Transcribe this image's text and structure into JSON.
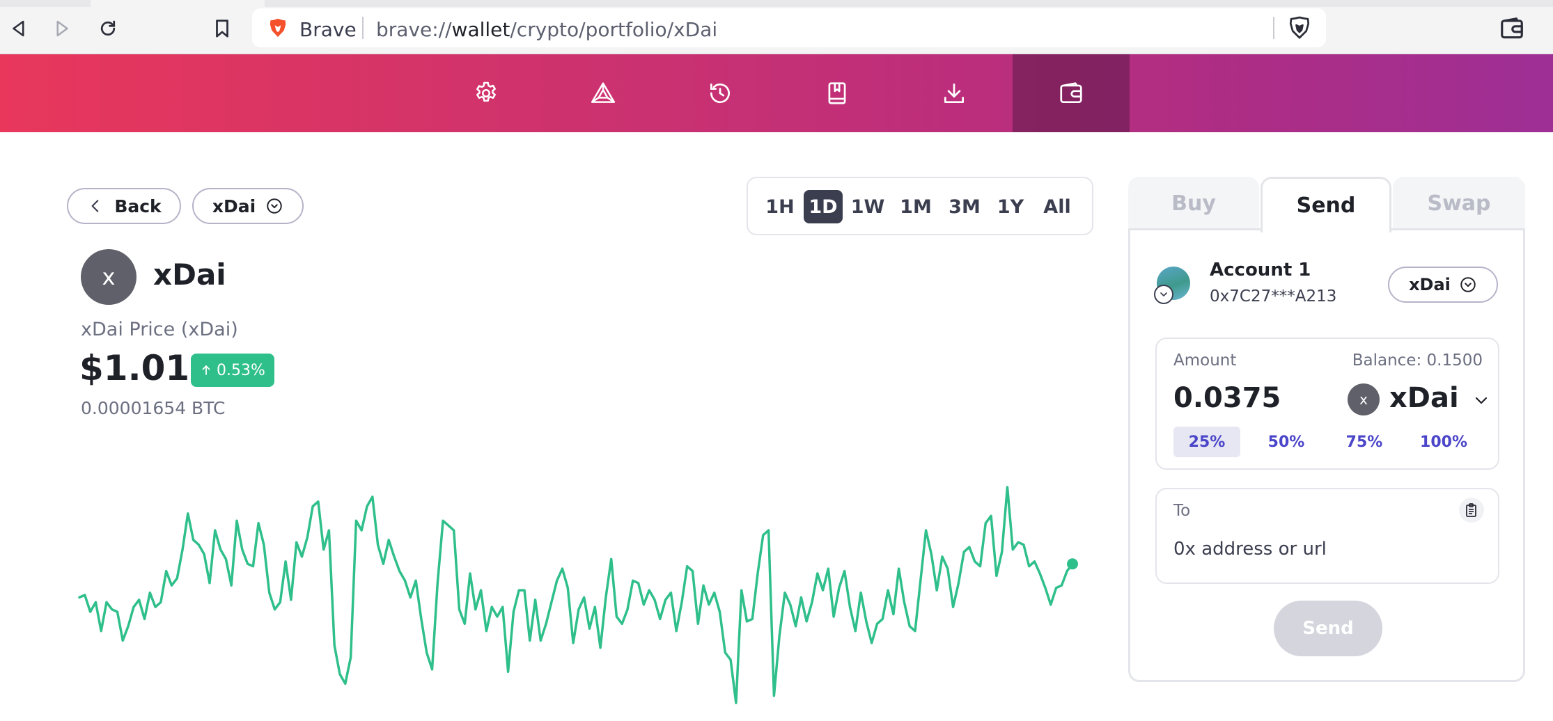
{
  "browser": {
    "brand": "Brave",
    "url_prefix": "brave://",
    "url_host": "wallet",
    "url_path": "/crypto/portfolio/xDai"
  },
  "nav": {
    "items": [
      {
        "name": "settings",
        "icon": "gear-icon"
      },
      {
        "name": "rewards",
        "icon": "bat-triangle-icon"
      },
      {
        "name": "history",
        "icon": "history-icon"
      },
      {
        "name": "bookmarks",
        "icon": "bookmark-book-icon"
      },
      {
        "name": "downloads",
        "icon": "download-icon"
      },
      {
        "name": "wallet",
        "icon": "wallet-icon",
        "active": true
      }
    ]
  },
  "header": {
    "back_label": "Back",
    "asset_selector_label": "xDai"
  },
  "timeframes": {
    "options": [
      "1H",
      "1D",
      "1W",
      "1M",
      "3M",
      "1Y",
      "All"
    ],
    "selected": "1D"
  },
  "asset": {
    "icon_letter": "x",
    "name": "xDai",
    "price_label": "xDai Price (xDai)",
    "price": "$1.010",
    "change": "0.53%",
    "change_direction": "up",
    "btc_value": "0.00001654 BTC"
  },
  "chart_data": {
    "type": "line",
    "color": "#2fbf8a",
    "values": [
      50,
      51,
      44,
      48,
      36,
      48,
      45,
      44,
      32,
      38,
      46,
      49,
      41,
      52,
      46,
      48,
      61,
      55,
      58,
      70,
      85,
      74,
      72,
      68,
      56,
      78,
      70,
      66,
      55,
      82,
      70,
      64,
      63,
      81,
      72,
      52,
      45,
      48,
      65,
      49,
      73,
      67,
      75,
      88,
      90,
      70,
      78,
      30,
      18,
      14,
      25,
      82,
      78,
      88,
      92,
      72,
      64,
      74,
      67,
      61,
      57,
      50,
      57,
      41,
      27,
      20,
      56,
      82,
      80,
      78,
      45,
      39,
      60,
      45,
      53,
      36,
      46,
      42,
      46,
      19,
      44,
      53,
      53,
      32,
      49,
      32,
      39,
      48,
      57,
      62,
      54,
      31,
      45,
      50,
      37,
      46,
      29,
      50,
      66,
      42,
      39,
      45,
      57,
      56,
      47,
      53,
      49,
      41,
      49,
      52,
      36,
      48,
      63,
      61,
      39,
      55,
      47,
      52,
      44,
      27,
      24,
      6,
      53,
      40,
      41,
      60,
      76,
      78,
      9,
      34,
      52,
      47,
      38,
      50,
      40,
      48,
      60,
      53,
      62,
      42,
      54,
      61,
      46,
      36,
      52,
      40,
      31,
      39,
      41,
      53,
      43,
      62,
      48,
      38,
      36,
      57,
      78,
      68,
      53,
      67,
      62,
      46,
      56,
      69,
      71,
      65,
      63,
      81,
      84,
      59,
      69,
      96,
      70,
      73,
      72,
      63,
      65,
      60,
      54,
      47,
      54,
      55,
      61,
      64
    ],
    "last_point_marker": true
  },
  "panel": {
    "tabs": [
      {
        "label": "Buy",
        "active": false
      },
      {
        "label": "Send",
        "active": true
      },
      {
        "label": "Swap",
        "active": false
      }
    ],
    "account": {
      "name": "Account 1",
      "address": "0x7C27***A213",
      "asset_label": "xDai"
    },
    "amount": {
      "label": "Amount",
      "balance_label": "Balance: 0.1500",
      "value": "0.0375",
      "asset_icon_letter": "x",
      "asset_name": "xDai",
      "percent_options": [
        "25%",
        "50%",
        "75%",
        "100%"
      ],
      "selected_percent": "25%"
    },
    "to": {
      "label": "To",
      "placeholder": "0x address or url"
    },
    "send_label": "Send"
  }
}
